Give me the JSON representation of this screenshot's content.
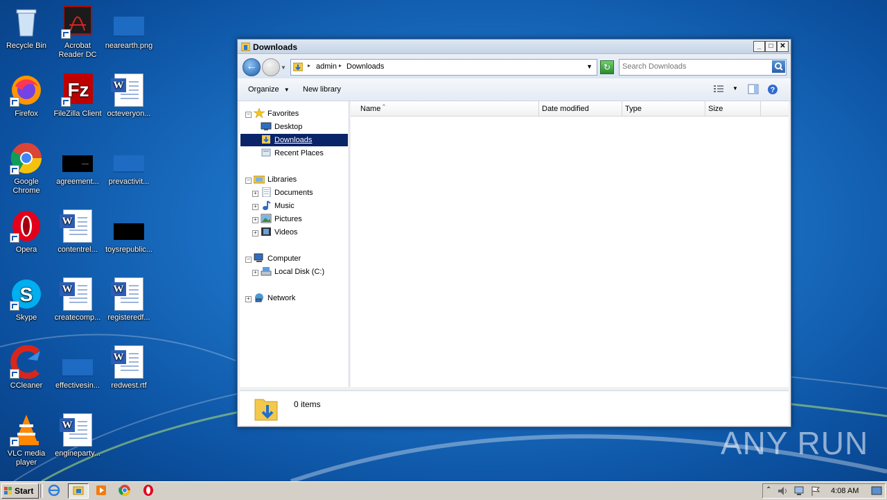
{
  "desktop": {
    "icons": [
      {
        "label": "Recycle Bin"
      },
      {
        "label": "Acrobat Reader DC"
      },
      {
        "label": "nearearth.png"
      },
      {
        "label": "Firefox"
      },
      {
        "label": "FileZilla Client"
      },
      {
        "label": "octeveryon..."
      },
      {
        "label": "Google Chrome"
      },
      {
        "label": "agreement..."
      },
      {
        "label": "prevactivit..."
      },
      {
        "label": "Opera"
      },
      {
        "label": "contentrel..."
      },
      {
        "label": "toysrepublic..."
      },
      {
        "label": "Skype"
      },
      {
        "label": "createcomp..."
      },
      {
        "label": "registeredf..."
      },
      {
        "label": "CCleaner"
      },
      {
        "label": "effectivesin..."
      },
      {
        "label": "redwest.rtf"
      },
      {
        "label": "VLC media player"
      },
      {
        "label": "engineparty..."
      }
    ]
  },
  "window": {
    "title": "Downloads",
    "breadcrumb": [
      "admin",
      "Downloads"
    ],
    "search_placeholder": "Search Downloads",
    "toolbar": {
      "organize": "Organize",
      "new_library": "New library"
    },
    "nav": {
      "favorites": "Favorites",
      "desktop": "Desktop",
      "downloads": "Downloads",
      "recent": "Recent Places",
      "libraries": "Libraries",
      "documents": "Documents",
      "music": "Music",
      "pictures": "Pictures",
      "videos": "Videos",
      "computer": "Computer",
      "local_disk": "Local Disk (C:)",
      "network": "Network"
    },
    "columns": [
      "Name",
      "Date modified",
      "Type",
      "Size"
    ],
    "status": "0 items"
  },
  "taskbar": {
    "start": "Start",
    "clock": "4:08 AM"
  },
  "watermark": "ANY RUN",
  "colors": {
    "accent": "#0a246a",
    "taskbar": "#d4d0c8"
  }
}
